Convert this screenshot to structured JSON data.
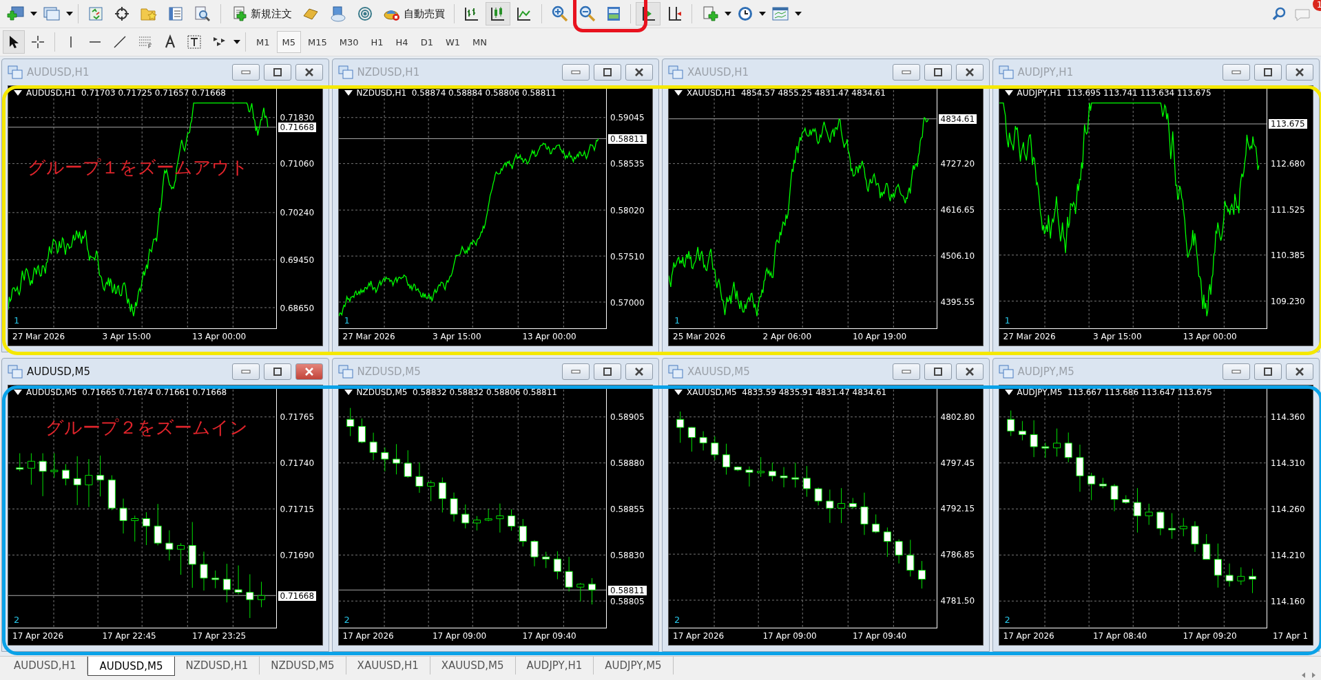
{
  "toolbar": {
    "new_order": "新規注文",
    "auto_trading": "自動売買",
    "notification_count": "1"
  },
  "timeframes": [
    {
      "label": "M1",
      "selected": false
    },
    {
      "label": "M5",
      "selected": true
    },
    {
      "label": "M15",
      "selected": false
    },
    {
      "label": "M30",
      "selected": false
    },
    {
      "label": "H1",
      "selected": false
    },
    {
      "label": "H4",
      "selected": false
    },
    {
      "label": "D1",
      "selected": false
    },
    {
      "label": "W1",
      "selected": false
    },
    {
      "label": "MN",
      "selected": false
    }
  ],
  "groups": [
    {
      "label": "グループ１をズームアウト",
      "color": "#f5e800"
    },
    {
      "label": "グループ２をズームイン",
      "color": "#0aa2e8"
    }
  ],
  "charts": [
    {
      "title": "AUDUSD,H1",
      "active": false,
      "kind": "line",
      "header": "AUDUSD,H1  0.71703 0.71725 0.71657 0.71668",
      "prices": [
        "0.71830",
        "0.71060",
        "0.70240",
        "0.69450",
        "0.68650"
      ],
      "current_price": "0.71668",
      "times": [
        "27 Mar 2026",
        "3 Apr 15:00",
        "13 Apr 00:00"
      ],
      "subwindow": "1"
    },
    {
      "title": "NZDUSD,H1",
      "active": false,
      "kind": "line",
      "header": "NZDUSD,H1  0.58874 0.58884 0.58806 0.58811",
      "prices": [
        "0.59045",
        "0.58535",
        "0.58020",
        "0.57510",
        "0.57000"
      ],
      "current_price": "0.58811",
      "times": [
        "27 Mar 2026",
        "3 Apr 15:00",
        "13 Apr 00:00"
      ],
      "subwindow": "1"
    },
    {
      "title": "XAUUSD,H1",
      "active": false,
      "kind": "line",
      "header": "XAUUSD,H1  4854.57 4855.25 4831.47 4834.61",
      "prices": [
        "4727.20",
        "4616.65",
        "4506.10",
        "4395.55"
      ],
      "current_price": "4834.61",
      "times": [
        "25 Mar 2026",
        "2 Apr 06:00",
        "10 Apr 19:00"
      ],
      "subwindow": "1"
    },
    {
      "title": "AUDJPY,H1",
      "active": false,
      "kind": "line",
      "header": "AUDJPY,H1  113.695 113.741 113.634 113.675",
      "prices": [
        "112.680",
        "111.525",
        "110.385",
        "109.230"
      ],
      "current_price": "113.675",
      "times": [
        "27 Mar 2026",
        "3 Apr 15:00",
        "13 Apr 00:00"
      ],
      "subwindow": "1"
    },
    {
      "title": "AUDUSD,M5",
      "active": true,
      "kind": "candles",
      "header": "AUDUSD,M5  0.71665 0.71674 0.71661 0.71668",
      "prices": [
        "0.71765",
        "0.71740",
        "0.71715",
        "0.71690"
      ],
      "current_price": "0.71668",
      "times": [
        "17 Apr 2026",
        "17 Apr 22:45",
        "17 Apr 23:25"
      ],
      "subwindow": "2"
    },
    {
      "title": "NZDUSD,M5",
      "active": false,
      "kind": "candles",
      "header": "NZDUSD,M5  0.58832 0.58832 0.58806 0.58811",
      "prices": [
        "0.58905",
        "0.58880",
        "0.58855",
        "0.58830",
        "0.58805"
      ],
      "current_price": "0.58811",
      "times": [
        "17 Apr 2026",
        "17 Apr 09:00",
        "17 Apr 09:40"
      ],
      "subwindow": "2"
    },
    {
      "title": "XAUUSD,M5",
      "active": false,
      "kind": "candles",
      "header": "XAUUSD,M5  4833.59 4835.91 4831.47 4834.61",
      "prices": [
        "4802.80",
        "4797.45",
        "4792.15",
        "4786.85",
        "4781.50"
      ],
      "times": [
        "17 Apr 2026",
        "17 Apr 09:00",
        "17 Apr 09:40"
      ],
      "subwindow": "2"
    },
    {
      "title": "AUDJPY,M5",
      "active": false,
      "kind": "candles",
      "header": "AUDJPY,M5  113.667 113.686 113.647 113.675",
      "prices": [
        "114.360",
        "114.310",
        "114.260",
        "114.210",
        "114.160"
      ],
      "times": [
        "17 Apr 2026",
        "17 Apr 08:40",
        "17 Apr 09:20",
        "17 Apr 1"
      ],
      "subwindow": "2"
    }
  ],
  "tabs": [
    {
      "label": "AUDUSD,H1",
      "selected": false
    },
    {
      "label": "AUDUSD,M5",
      "selected": true
    },
    {
      "label": "NZDUSD,H1",
      "selected": false
    },
    {
      "label": "NZDUSD,M5",
      "selected": false
    },
    {
      "label": "XAUUSD,H1",
      "selected": false
    },
    {
      "label": "XAUUSD,M5",
      "selected": false
    },
    {
      "label": "AUDJPY,H1",
      "selected": false
    },
    {
      "label": "AUDJPY,M5",
      "selected": false
    }
  ]
}
